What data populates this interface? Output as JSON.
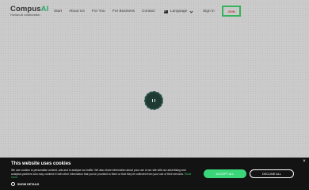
{
  "logo": {
    "name_prefix": "Compus",
    "name_suffix": "AI",
    "tagline": "Human-AI collaboration"
  },
  "nav": {
    "items": [
      "Start",
      "About Us",
      "For You",
      "For Business",
      "Contact"
    ],
    "language_label": "Language",
    "signin_label": "Sign in",
    "join_label": "JOIN"
  },
  "loader": {
    "icon": "pause-icon"
  },
  "cookie": {
    "title": "This website uses cookies",
    "text": "We use cookies to personalise content, ads and to analyse our traffic. We also share information about your use of our site with our advertising and analytics partners who may combine it with other information that you've provided to them or that they've collected from your use of their services.",
    "read_more": "Read more",
    "show_details": "SHOW DETAILS",
    "accept_label": "ACCEPT ALL",
    "decline_label": "DECLINE ALL",
    "close_glyph": "×"
  },
  "colors": {
    "accent": "#3cd67a",
    "banner_bg": "#131313",
    "join_border": "#35b35a",
    "loader_bg": "#1f3a33"
  }
}
